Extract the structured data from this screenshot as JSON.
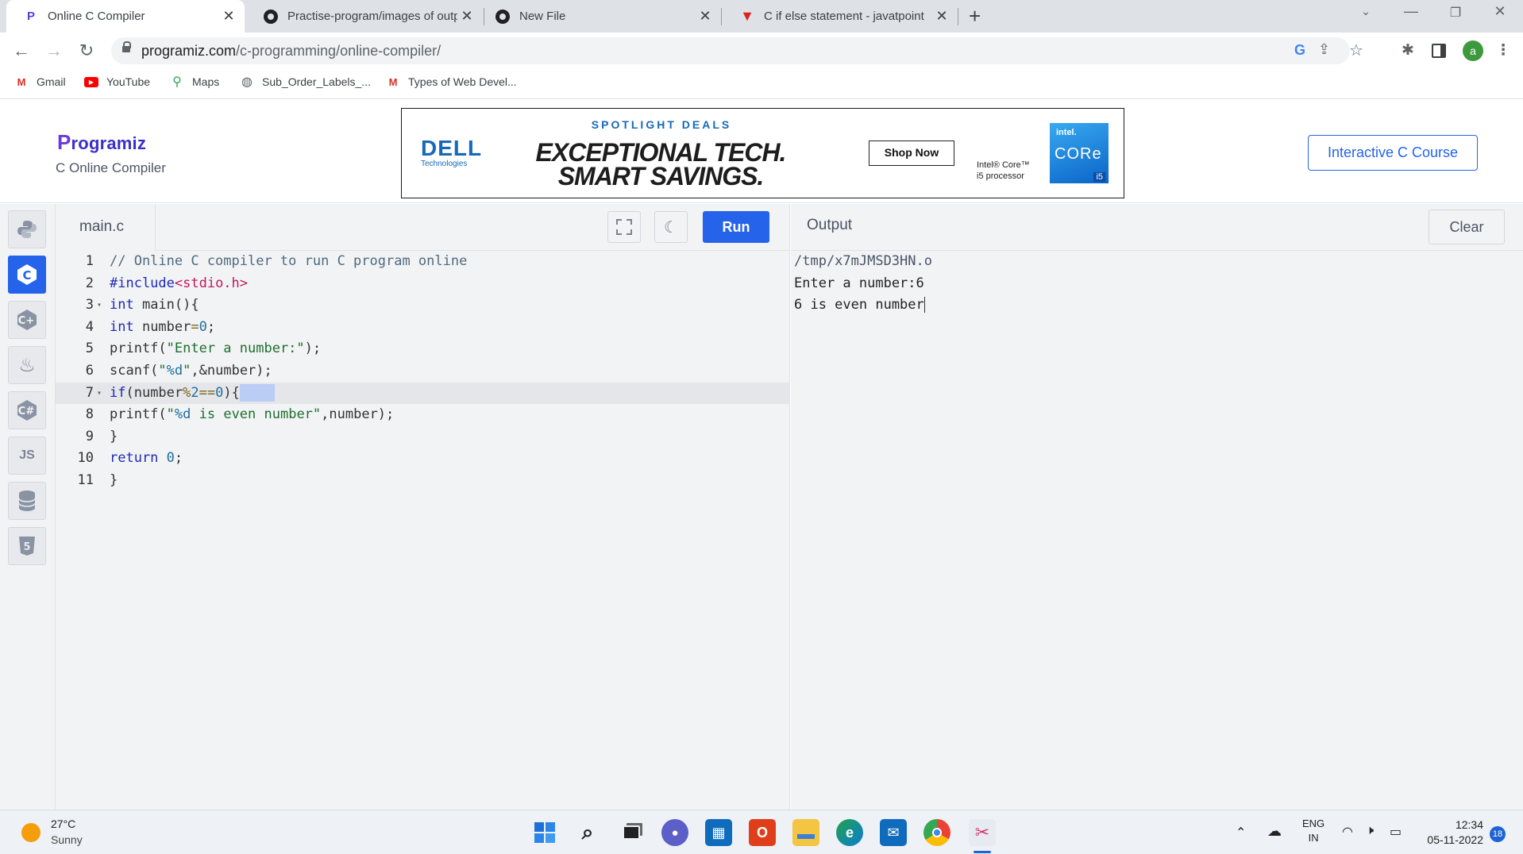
{
  "browser": {
    "tabs": [
      {
        "title": "Online C Compiler",
        "favicon": "programiz-icon",
        "active": true
      },
      {
        "title": "Practise-program/images of outp",
        "favicon": "github-icon"
      },
      {
        "title": "New File",
        "favicon": "github-icon"
      },
      {
        "title": "C if else statement - javatpoint",
        "favicon": "javatpoint-icon"
      }
    ],
    "url_domain": "programiz.com",
    "url_path": "/c-programming/online-compiler/",
    "profile_initial": "a",
    "bookmarks": [
      "Gmail",
      "YouTube",
      "Maps",
      "Sub_Order_Labels_...",
      "Types of Web Devel..."
    ]
  },
  "site": {
    "logo": "rogramiz",
    "logo_initial": "P",
    "subtitle": "C Online Compiler",
    "course_button": "Interactive C Course"
  },
  "ad": {
    "tagline": "SPOTLIGHT DEALS",
    "brand": "DELL",
    "brand_sub": "Technologies",
    "headline_1": "EXCEPTIONAL TECH.",
    "headline_2": "SMART SAVINGS.",
    "cta": "Shop Now",
    "processor_1": "Intel® Core™",
    "processor_2": "i5 processor",
    "badge_brand": "intel.",
    "badge_core": "CORe",
    "badge_gen": "i5"
  },
  "sidebar": {
    "languages": [
      "python",
      "c",
      "cpp",
      "java",
      "csharp",
      "javascript",
      "sql",
      "html"
    ],
    "active": "c",
    "js_label": "JS"
  },
  "editor": {
    "filename": "main.c",
    "run_label": "Run",
    "highlighted_line": 7,
    "line_numbers": [
      "1",
      "2",
      "3",
      "4",
      "5",
      "6",
      "7",
      "8",
      "9",
      "10",
      "11"
    ],
    "folded_lines": [
      3,
      7
    ],
    "lines": [
      "// Online C compiler to run C program online",
      "#include<stdio.h>",
      "int main(){",
      "int number=0;",
      "printf(\"Enter a number:\");",
      "scanf(\"%d\",&number);",
      "if(number%2==0){",
      "printf(\"%d is even number\",number);",
      "}",
      "return 0;",
      "}"
    ]
  },
  "output": {
    "label": "Output",
    "clear_label": "Clear",
    "lines": [
      "/tmp/x7mJMSD3HN.o",
      "Enter a number:6",
      "6 is even number"
    ]
  },
  "taskbar": {
    "temperature": "27°C",
    "condition": "Sunny",
    "language_1": "ENG",
    "language_2": "IN",
    "time": "12:34",
    "date": "05-11-2022",
    "notifications": "18"
  }
}
